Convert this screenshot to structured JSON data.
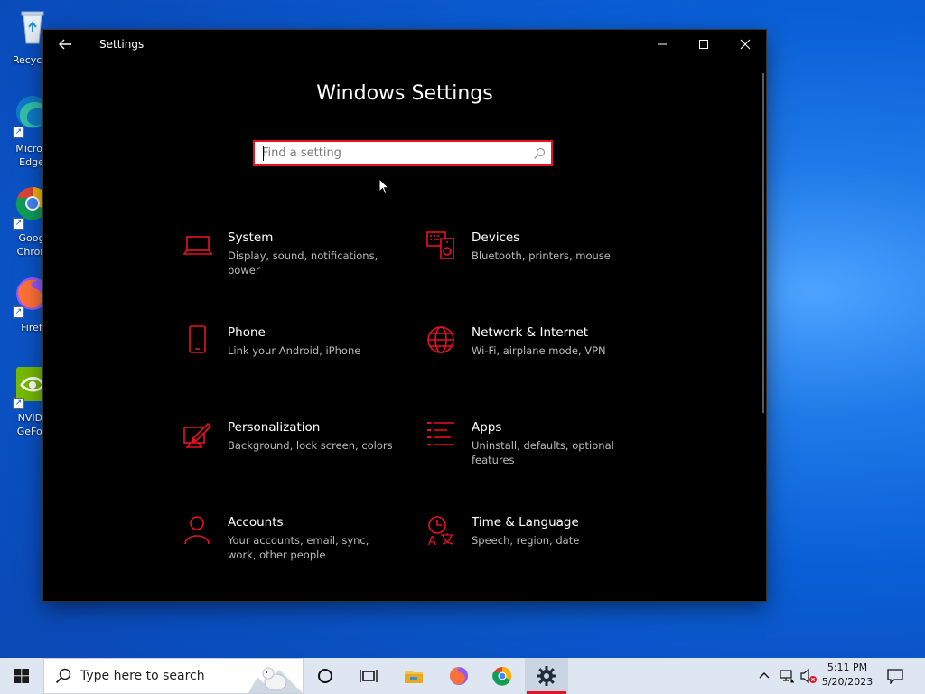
{
  "desktop": {
    "icons": [
      {
        "label_lines": [
          "Recycle"
        ]
      },
      {
        "label_lines": [
          "Micros",
          "Edge"
        ]
      },
      {
        "label_lines": [
          "Goog",
          "Chron"
        ]
      },
      {
        "label_lines": [
          "Firef"
        ]
      },
      {
        "label_lines": [
          "NVIDI",
          "GeFor"
        ]
      }
    ]
  },
  "window": {
    "title": "Settings",
    "heading": "Windows Settings",
    "search": {
      "placeholder": "Find a setting"
    },
    "accent_color": "#e81123",
    "tiles": [
      {
        "icon": "laptop-icon",
        "title": "System",
        "desc": "Display, sound, notifications, power"
      },
      {
        "icon": "devices-icon",
        "title": "Devices",
        "desc": "Bluetooth, printers, mouse"
      },
      {
        "icon": "phone-icon",
        "title": "Phone",
        "desc": "Link your Android, iPhone"
      },
      {
        "icon": "globe-icon",
        "title": "Network & Internet",
        "desc": "Wi-Fi, airplane mode, VPN"
      },
      {
        "icon": "personalization-icon",
        "title": "Personalization",
        "desc": "Background, lock screen, colors"
      },
      {
        "icon": "apps-icon",
        "title": "Apps",
        "desc": "Uninstall, defaults, optional features"
      },
      {
        "icon": "person-icon",
        "title": "Accounts",
        "desc": "Your accounts, email, sync, work, other people"
      },
      {
        "icon": "time-language-icon",
        "title": "Time & Language",
        "desc": "Speech, region, date"
      }
    ]
  },
  "taskbar": {
    "search_placeholder": "Type here to search",
    "clock": {
      "time": "5:11 PM",
      "date": "5/20/2023"
    }
  }
}
